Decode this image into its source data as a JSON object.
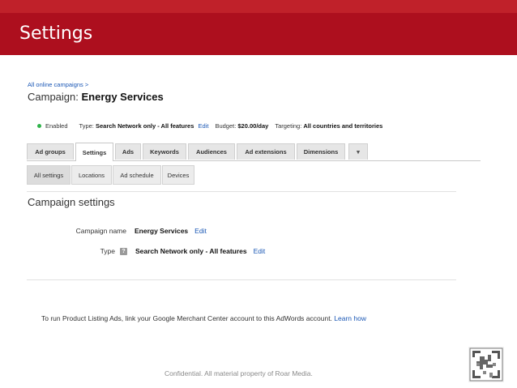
{
  "slide": {
    "title": "Settings",
    "footer": "Confidential. All material property of Roar Media."
  },
  "breadcrumb": "All online campaigns >",
  "campaign": {
    "prefix": "Campaign:",
    "name": "Energy Services"
  },
  "status": {
    "enabled": "Enabled",
    "type_label": "Type:",
    "type_value": "Search Network only - All features",
    "type_edit": "Edit",
    "budget_label": "Budget:",
    "budget_value": "$20.00/day",
    "targeting_label": "Targeting:",
    "targeting_value": "All countries and territories"
  },
  "tabs": [
    {
      "label": "Ad groups"
    },
    {
      "label": "Settings"
    },
    {
      "label": "Ads"
    },
    {
      "label": "Keywords"
    },
    {
      "label": "Audiences"
    },
    {
      "label": "Ad extensions"
    },
    {
      "label": "Dimensions"
    }
  ],
  "tab_more": "▾",
  "subtabs": [
    {
      "label": "All settings"
    },
    {
      "label": "Locations"
    },
    {
      "label": "Ad schedule"
    },
    {
      "label": "Devices"
    }
  ],
  "settings": {
    "section_title": "Campaign settings",
    "name_label": "Campaign name",
    "name_value": "Energy Services",
    "name_edit": "Edit",
    "type_label": "Type",
    "type_help": "?",
    "type_value": "Search Network only - All features",
    "type_edit": "Edit"
  },
  "merchant": {
    "text": "To run Product Listing Ads, link your Google Merchant Center account to this AdWords account.",
    "link": "Learn how"
  },
  "colors": {
    "header": "#ad0f1e",
    "header_strip": "#c0212a",
    "link": "#1a57b5",
    "enabled_dot": "#2fb34a"
  }
}
